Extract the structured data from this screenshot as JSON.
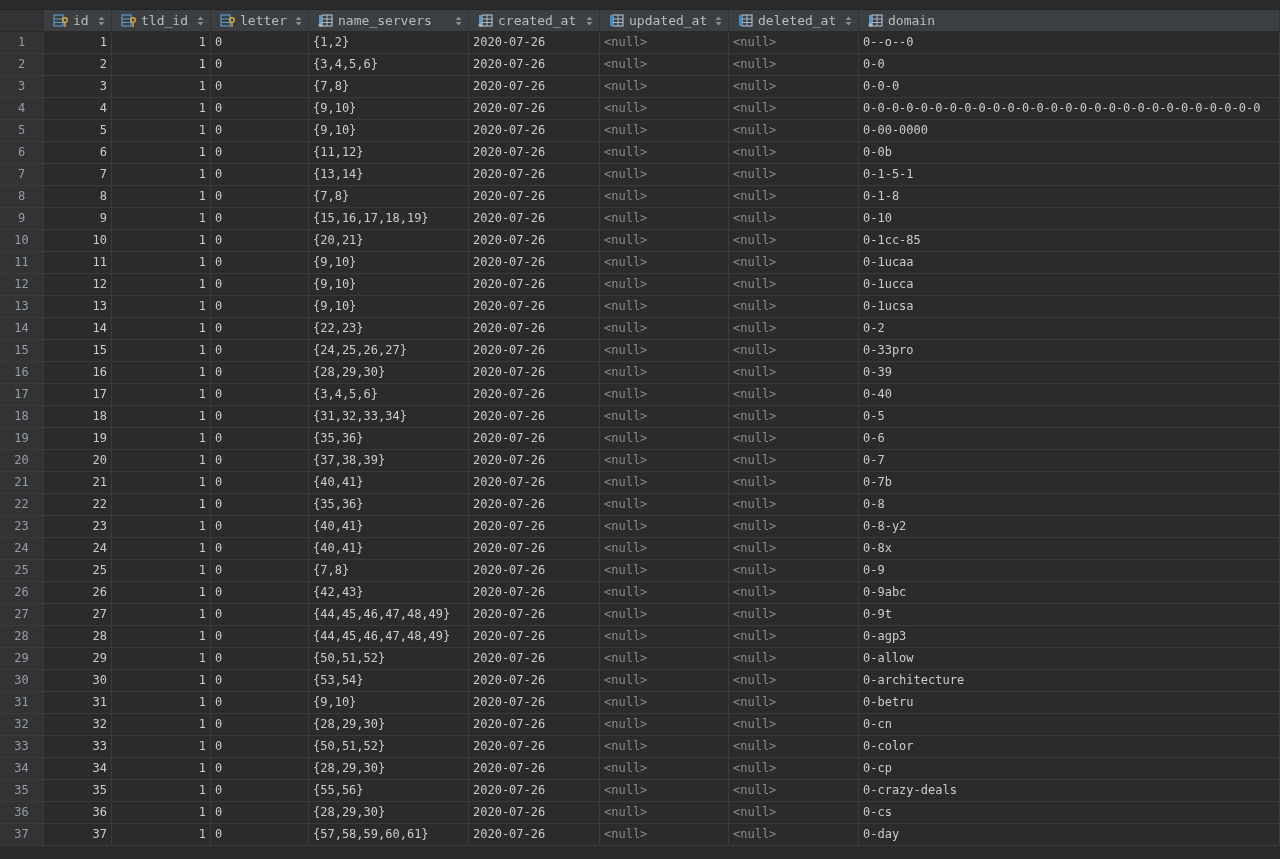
{
  "columns": [
    {
      "name": "id",
      "kind": "keynumber",
      "sortable": true
    },
    {
      "name": "tld_id",
      "kind": "keynumber",
      "sortable": true
    },
    {
      "name": "letter",
      "kind": "key",
      "sortable": true
    },
    {
      "name": "name_servers",
      "kind": "column",
      "sortable": true
    },
    {
      "name": "created_at",
      "kind": "column",
      "sortable": true
    },
    {
      "name": "updated_at",
      "kind": "nullable",
      "sortable": true
    },
    {
      "name": "deleted_at",
      "kind": "nullable",
      "sortable": true
    },
    {
      "name": "domain",
      "kind": "column",
      "sortable": false
    }
  ],
  "rows": [
    {
      "number": "1",
      "cells": [
        "1",
        "1",
        "0",
        "{1,2}",
        "2020-07-26",
        "<null>",
        "<null>",
        "0--o--0"
      ]
    },
    {
      "number": "2",
      "cells": [
        "2",
        "1",
        "0",
        "{3,4,5,6}",
        "2020-07-26",
        "<null>",
        "<null>",
        "0-0"
      ]
    },
    {
      "number": "3",
      "cells": [
        "3",
        "1",
        "0",
        "{7,8}",
        "2020-07-26",
        "<null>",
        "<null>",
        "0-0-0"
      ]
    },
    {
      "number": "4",
      "cells": [
        "4",
        "1",
        "0",
        "{9,10}",
        "2020-07-26",
        "<null>",
        "<null>",
        "0-0-0-0-0-0-0-0-0-0-0-0-0-0-0-0-0-0-0-0-0-0-0-0-0-0-0-0"
      ]
    },
    {
      "number": "5",
      "cells": [
        "5",
        "1",
        "0",
        "{9,10}",
        "2020-07-26",
        "<null>",
        "<null>",
        "0-00-0000"
      ]
    },
    {
      "number": "6",
      "cells": [
        "6",
        "1",
        "0",
        "{11,12}",
        "2020-07-26",
        "<null>",
        "<null>",
        "0-0b"
      ]
    },
    {
      "number": "7",
      "cells": [
        "7",
        "1",
        "0",
        "{13,14}",
        "2020-07-26",
        "<null>",
        "<null>",
        "0-1-5-1"
      ]
    },
    {
      "number": "8",
      "cells": [
        "8",
        "1",
        "0",
        "{7,8}",
        "2020-07-26",
        "<null>",
        "<null>",
        "0-1-8"
      ]
    },
    {
      "number": "9",
      "cells": [
        "9",
        "1",
        "0",
        "{15,16,17,18,19}",
        "2020-07-26",
        "<null>",
        "<null>",
        "0-10"
      ]
    },
    {
      "number": "10",
      "cells": [
        "10",
        "1",
        "0",
        "{20,21}",
        "2020-07-26",
        "<null>",
        "<null>",
        "0-1cc-85"
      ]
    },
    {
      "number": "11",
      "cells": [
        "11",
        "1",
        "0",
        "{9,10}",
        "2020-07-26",
        "<null>",
        "<null>",
        "0-1ucaa"
      ]
    },
    {
      "number": "12",
      "cells": [
        "12",
        "1",
        "0",
        "{9,10}",
        "2020-07-26",
        "<null>",
        "<null>",
        "0-1ucca"
      ]
    },
    {
      "number": "13",
      "cells": [
        "13",
        "1",
        "0",
        "{9,10}",
        "2020-07-26",
        "<null>",
        "<null>",
        "0-1ucsa"
      ]
    },
    {
      "number": "14",
      "cells": [
        "14",
        "1",
        "0",
        "{22,23}",
        "2020-07-26",
        "<null>",
        "<null>",
        "0-2"
      ]
    },
    {
      "number": "15",
      "cells": [
        "15",
        "1",
        "0",
        "{24,25,26,27}",
        "2020-07-26",
        "<null>",
        "<null>",
        "0-33pro"
      ]
    },
    {
      "number": "16",
      "cells": [
        "16",
        "1",
        "0",
        "{28,29,30}",
        "2020-07-26",
        "<null>",
        "<null>",
        "0-39"
      ]
    },
    {
      "number": "17",
      "cells": [
        "17",
        "1",
        "0",
        "{3,4,5,6}",
        "2020-07-26",
        "<null>",
        "<null>",
        "0-40"
      ]
    },
    {
      "number": "18",
      "cells": [
        "18",
        "1",
        "0",
        "{31,32,33,34}",
        "2020-07-26",
        "<null>",
        "<null>",
        "0-5"
      ]
    },
    {
      "number": "19",
      "cells": [
        "19",
        "1",
        "0",
        "{35,36}",
        "2020-07-26",
        "<null>",
        "<null>",
        "0-6"
      ]
    },
    {
      "number": "20",
      "cells": [
        "20",
        "1",
        "0",
        "{37,38,39}",
        "2020-07-26",
        "<null>",
        "<null>",
        "0-7"
      ]
    },
    {
      "number": "21",
      "cells": [
        "21",
        "1",
        "0",
        "{40,41}",
        "2020-07-26",
        "<null>",
        "<null>",
        "0-7b"
      ]
    },
    {
      "number": "22",
      "cells": [
        "22",
        "1",
        "0",
        "{35,36}",
        "2020-07-26",
        "<null>",
        "<null>",
        "0-8"
      ]
    },
    {
      "number": "23",
      "cells": [
        "23",
        "1",
        "0",
        "{40,41}",
        "2020-07-26",
        "<null>",
        "<null>",
        "0-8-y2"
      ]
    },
    {
      "number": "24",
      "cells": [
        "24",
        "1",
        "0",
        "{40,41}",
        "2020-07-26",
        "<null>",
        "<null>",
        "0-8x"
      ]
    },
    {
      "number": "25",
      "cells": [
        "25",
        "1",
        "0",
        "{7,8}",
        "2020-07-26",
        "<null>",
        "<null>",
        "0-9"
      ]
    },
    {
      "number": "26",
      "cells": [
        "26",
        "1",
        "0",
        "{42,43}",
        "2020-07-26",
        "<null>",
        "<null>",
        "0-9abc"
      ]
    },
    {
      "number": "27",
      "cells": [
        "27",
        "1",
        "0",
        "{44,45,46,47,48,49}",
        "2020-07-26",
        "<null>",
        "<null>",
        "0-9t"
      ]
    },
    {
      "number": "28",
      "cells": [
        "28",
        "1",
        "0",
        "{44,45,46,47,48,49}",
        "2020-07-26",
        "<null>",
        "<null>",
        "0-agp3"
      ]
    },
    {
      "number": "29",
      "cells": [
        "29",
        "1",
        "0",
        "{50,51,52}",
        "2020-07-26",
        "<null>",
        "<null>",
        "0-allow"
      ]
    },
    {
      "number": "30",
      "cells": [
        "30",
        "1",
        "0",
        "{53,54}",
        "2020-07-26",
        "<null>",
        "<null>",
        "0-architecture"
      ]
    },
    {
      "number": "31",
      "cells": [
        "31",
        "1",
        "0",
        "{9,10}",
        "2020-07-26",
        "<null>",
        "<null>",
        "0-betru"
      ]
    },
    {
      "number": "32",
      "cells": [
        "32",
        "1",
        "0",
        "{28,29,30}",
        "2020-07-26",
        "<null>",
        "<null>",
        "0-cn"
      ]
    },
    {
      "number": "33",
      "cells": [
        "33",
        "1",
        "0",
        "{50,51,52}",
        "2020-07-26",
        "<null>",
        "<null>",
        "0-color"
      ]
    },
    {
      "number": "34",
      "cells": [
        "34",
        "1",
        "0",
        "{28,29,30}",
        "2020-07-26",
        "<null>",
        "<null>",
        "0-cp"
      ]
    },
    {
      "number": "35",
      "cells": [
        "35",
        "1",
        "0",
        "{55,56}",
        "2020-07-26",
        "<null>",
        "<null>",
        "0-crazy-deals"
      ]
    },
    {
      "number": "36",
      "cells": [
        "36",
        "1",
        "0",
        "{28,29,30}",
        "2020-07-26",
        "<null>",
        "<null>",
        "0-cs"
      ]
    },
    {
      "number": "37",
      "cells": [
        "37",
        "1",
        "0",
        "{57,58,59,60,61}",
        "2020-07-26",
        "<null>",
        "<null>",
        "0-day"
      ]
    }
  ]
}
